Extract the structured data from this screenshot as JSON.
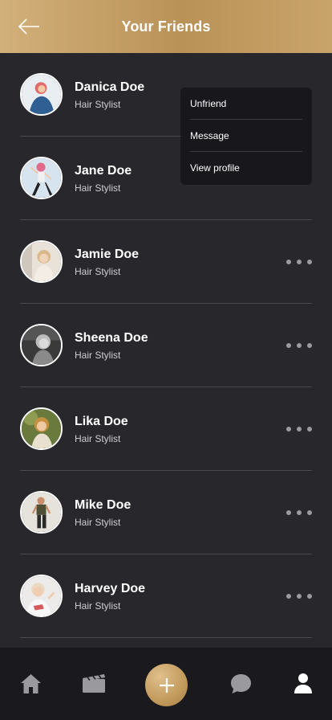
{
  "header": {
    "title": "Your Friends",
    "back_icon": "arrow-left-icon"
  },
  "friends": [
    {
      "name": "Danica Doe",
      "role": "Hair Stylist"
    },
    {
      "name": "Jane Doe",
      "role": "Hair Stylist"
    },
    {
      "name": "Jamie Doe",
      "role": "Hair Stylist"
    },
    {
      "name": "Sheena Doe",
      "role": "Hair Stylist"
    },
    {
      "name": "Lika Doe",
      "role": "Hair Stylist"
    },
    {
      "name": "Mike Doe",
      "role": "Hair Stylist"
    },
    {
      "name": "Harvey Doe",
      "role": "Hair Stylist"
    }
  ],
  "context_menu": {
    "items": [
      "Unfriend",
      "Message",
      "View profile"
    ]
  },
  "tabbar": {
    "icons": [
      "home-icon",
      "film-icon",
      "plus-icon",
      "chat-icon",
      "profile-icon"
    ]
  },
  "colors": {
    "accent": "#c29a5c",
    "background": "#28272b",
    "tabbar": "#1a191d"
  }
}
